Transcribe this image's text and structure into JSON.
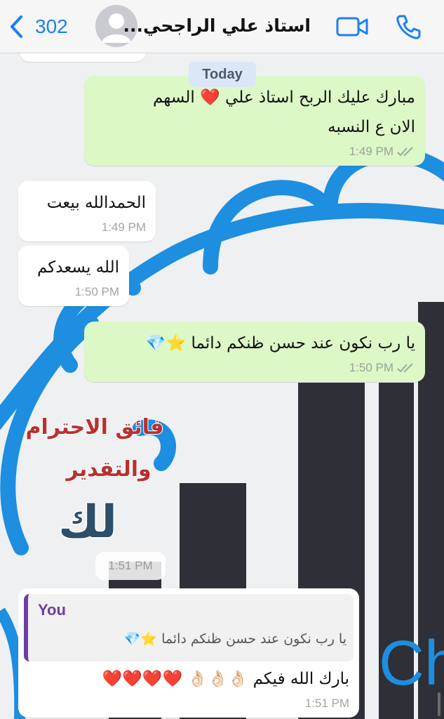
{
  "header": {
    "back_count": "302",
    "contact_name": "استاذ علي الراجحي..."
  },
  "day_chip": "Today",
  "messages": [
    {
      "text_line1": "مبارك عليك الربح استاذ علي ❤️ السهم",
      "text_line2": "الان ع النسبه",
      "time": "1:49 PM"
    },
    {
      "text": "الحمدالله بيعت",
      "time": "1:49 PM"
    },
    {
      "text": "الله يسعدكم",
      "time": "1:50 PM"
    },
    {
      "text": "يا رب نكون عند حسن ظنكم دائما ⭐💎",
      "time": "1:50 PM"
    }
  ],
  "sticker": {
    "line1": "فائق الاحترام",
    "line2": "والتقدير",
    "line3": "لك",
    "time": "1:51 PM"
  },
  "reply": {
    "quoted_author": "You",
    "quoted_text": "يا رب نكون عند حسن ظنكم دائما ⭐💎",
    "text": "بارك الله فيكم 👌🏻👌🏻👌🏻 ❤️❤️❤️❤️",
    "time": "1:51 PM"
  },
  "colors": {
    "accent": "#1b7ff5",
    "outgoing_bubble": "#dcf8c6",
    "incoming_bubble": "#ffffff",
    "reply_author": "#6b3fa0"
  }
}
